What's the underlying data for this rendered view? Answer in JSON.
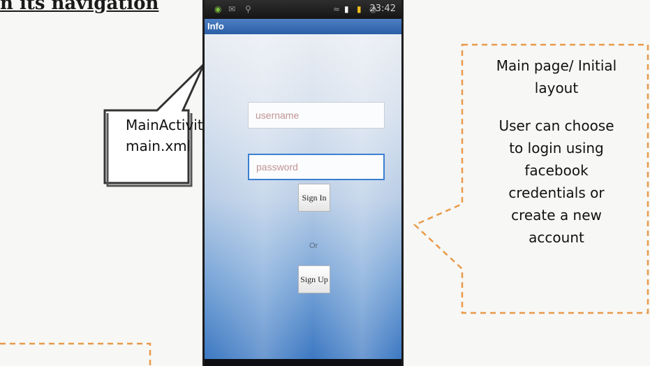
{
  "heading": "n its navigation",
  "left_callout": {
    "lines": [
      "MainActivity.java",
      "main.xml"
    ]
  },
  "phone": {
    "status": {
      "time": "23:42"
    },
    "title": "Info",
    "username_placeholder": "username",
    "password_placeholder": "password",
    "sign_in_label": "Sign In",
    "or_label": "Or",
    "sign_up_label": "Sign Up",
    "icons": [
      "notification-icon",
      "mail-icon",
      "usb-icon",
      "wifi-icon",
      "signal-icon",
      "battery-icon",
      "alarm-icon"
    ]
  },
  "right_callout": {
    "title_line1": "Main page/ Initial",
    "title_line2": "layout",
    "desc_lines": [
      "User can choose",
      "to login using",
      "facebook",
      "credentials or",
      "create a new",
      "account"
    ]
  },
  "colors": {
    "title_bar": "#2a5ea6",
    "focus_border": "#3b7fd1",
    "callout_dash": "#e89a4a"
  }
}
